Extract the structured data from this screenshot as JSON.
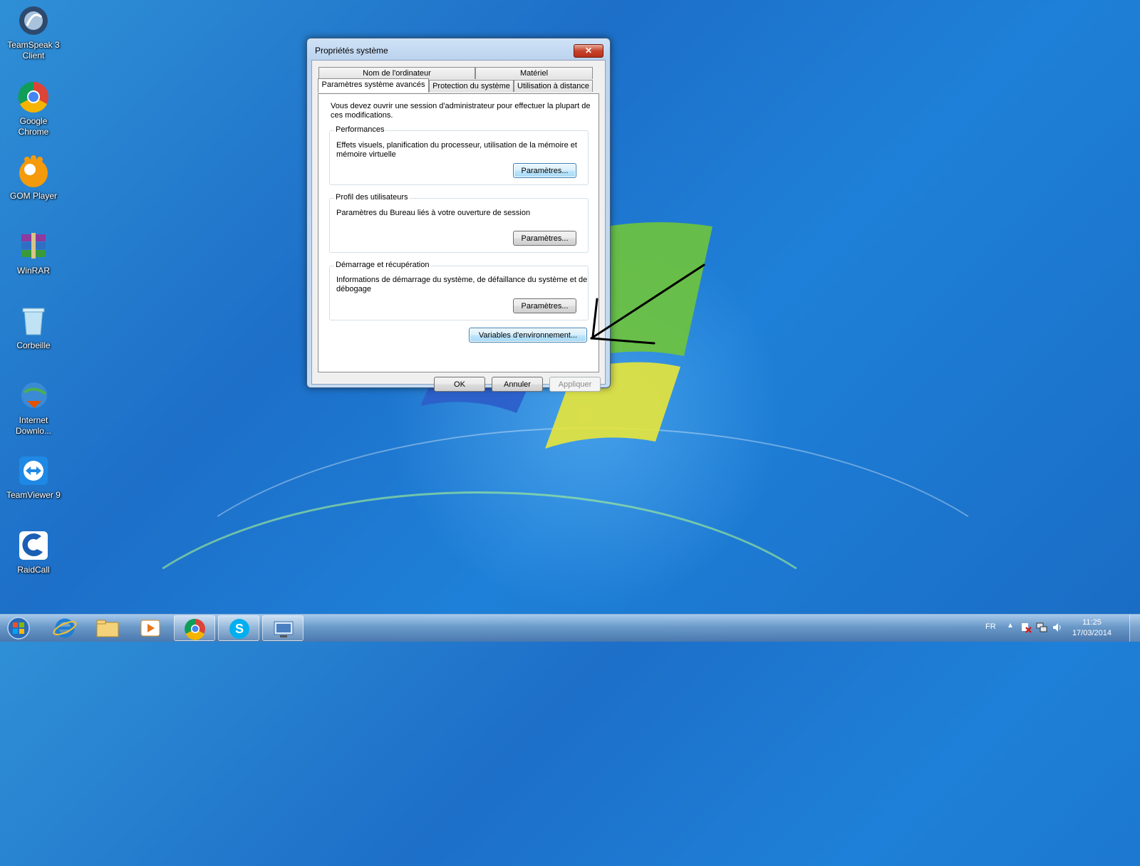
{
  "desktop": {
    "icons": [
      {
        "label": "TeamSpeak 3 Client",
        "line1": "TeamSpeak 3",
        "line2": "Client"
      },
      {
        "label": "Google Chrome",
        "line1": "Google Chrome",
        "line2": ""
      },
      {
        "label": "GOM Player",
        "line1": "GOM Player",
        "line2": ""
      },
      {
        "label": "WinRAR",
        "line1": "WinRAR",
        "line2": ""
      },
      {
        "label": "Corbeille",
        "line1": "Corbeille",
        "line2": ""
      },
      {
        "label": "Internet Downlo...",
        "line1": "Internet",
        "line2": "Downlo..."
      },
      {
        "label": "TeamViewer 9",
        "line1": "TeamViewer 9",
        "line2": ""
      },
      {
        "label": "RaidCall",
        "line1": "RaidCall",
        "line2": ""
      }
    ]
  },
  "dialog": {
    "title": "Propriétés système",
    "close_label": "✕",
    "tabs_row1": [
      "Nom de l'ordinateur",
      "Matériel"
    ],
    "tabs_row2": [
      "Paramètres système avancés",
      "Protection du système",
      "Utilisation à distance"
    ],
    "admin_note": "Vous devez ouvrir une session d'administrateur pour effectuer la plupart de ces modifications.",
    "admin_note_l1": "Vous devez ouvrir une session d'administrateur pour effectuer la plupart de",
    "admin_note_l2": "ces modifications.",
    "groups": {
      "performance": {
        "legend": "Performances",
        "desc_l1": "Effets visuels, planification du processeur, utilisation de la mémoire et",
        "desc_l2": "mémoire virtuelle",
        "button": "Paramètres..."
      },
      "profiles": {
        "legend": "Profil des utilisateurs",
        "desc_l1": "Paramètres du Bureau liés à votre ouverture de session",
        "button": "Paramètres..."
      },
      "startup": {
        "legend": "Démarrage et récupération",
        "desc_l1": "Informations de démarrage du système, de défaillance du système et de",
        "desc_l2": "débogage",
        "button": "Paramètres..."
      }
    },
    "env_button": "Variables d'environnement...",
    "ok": "OK",
    "cancel": "Annuler",
    "apply": "Appliquer"
  },
  "taskbar": {
    "start_icon": "windows-orb-icon",
    "pinned": [
      "internet-explorer-icon",
      "explorer-folder-icon",
      "media-player-icon",
      "chrome-icon",
      "skype-icon",
      "system-properties-icon"
    ],
    "language": "FR",
    "time": "11:25",
    "date": "17/03/2014"
  },
  "annotation": {
    "arrow_color": "#000000"
  }
}
